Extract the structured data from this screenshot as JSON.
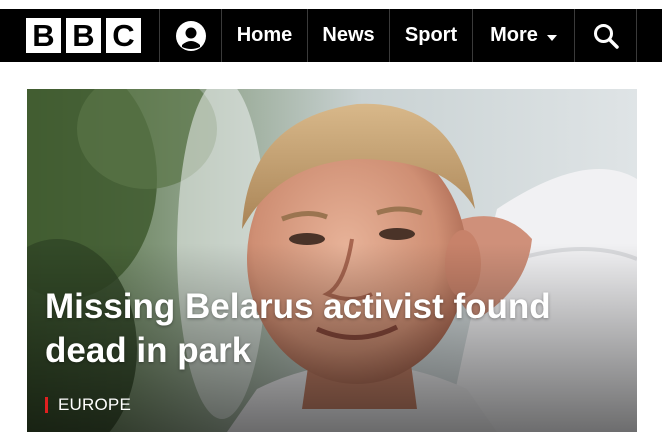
{
  "brand": {
    "logo_letters": [
      "B",
      "B",
      "C"
    ],
    "accent_color": "#e02020"
  },
  "nav": {
    "account_icon": "account-icon",
    "items": [
      {
        "label": "Home"
      },
      {
        "label": "News"
      },
      {
        "label": "Sport"
      },
      {
        "label": "More"
      }
    ],
    "more_icon": "chevron-down-icon",
    "search_icon": "search-icon"
  },
  "hero": {
    "headline": "Missing Belarus activist found dead in park",
    "section": "EUROPE",
    "image_subject": "man-portrait-photo"
  }
}
